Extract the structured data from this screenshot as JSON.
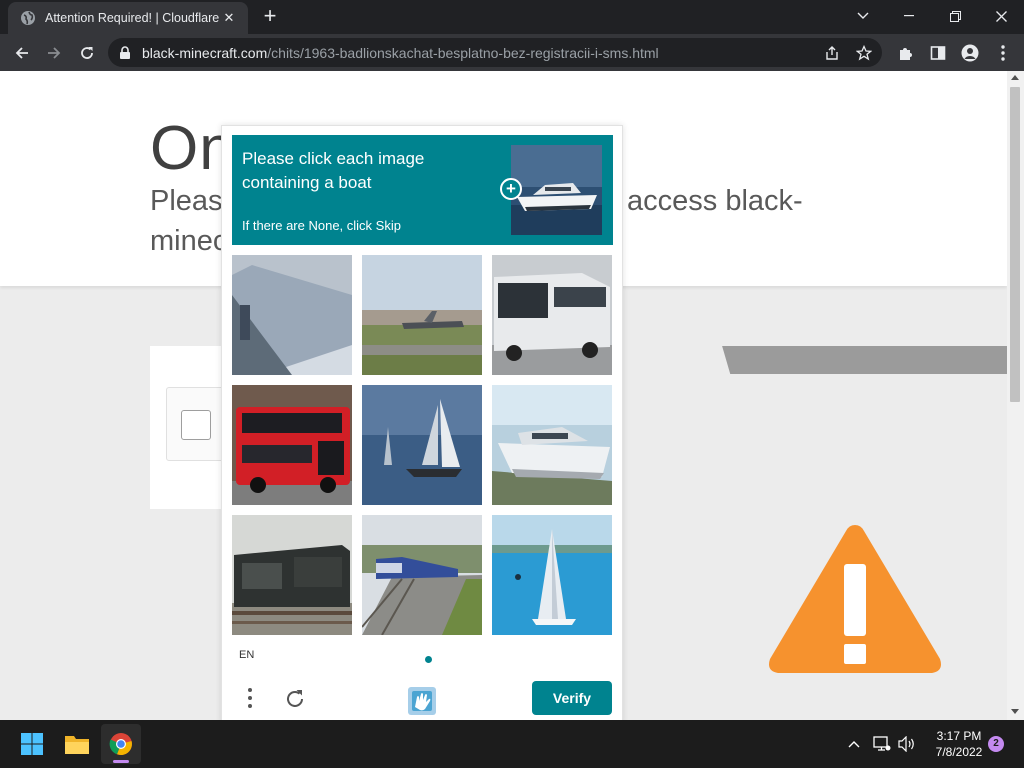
{
  "browser": {
    "tab_title": "Attention Required! | Cloudflare",
    "new_tab_label": "+",
    "url_host": "black-minecraft.com",
    "url_path": "/chits/1963-badlionskachat-besplatno-bez-registracii-i-sms.html"
  },
  "page": {
    "title_partial": "On",
    "subtitle_left": "Please",
    "subtitle_left_line2": "minec",
    "subtitle_right": "access black-"
  },
  "captcha": {
    "prompt": "Please click each image containing a boat",
    "hint": "If there are None, click Skip",
    "example_label": "boat",
    "tiles": [
      {
        "label": "train platform"
      },
      {
        "label": "airplane on runway"
      },
      {
        "label": "bus"
      },
      {
        "label": "red double-decker bus"
      },
      {
        "label": "sailboat"
      },
      {
        "label": "motor boat"
      },
      {
        "label": "locomotive"
      },
      {
        "label": "passenger train"
      },
      {
        "label": "sailboat on water"
      }
    ],
    "language": "EN",
    "verify_label": "Verify",
    "accent_color": "#00838f"
  },
  "taskbar": {
    "time": "3:17 PM",
    "date": "7/8/2022",
    "notifications": "2"
  }
}
